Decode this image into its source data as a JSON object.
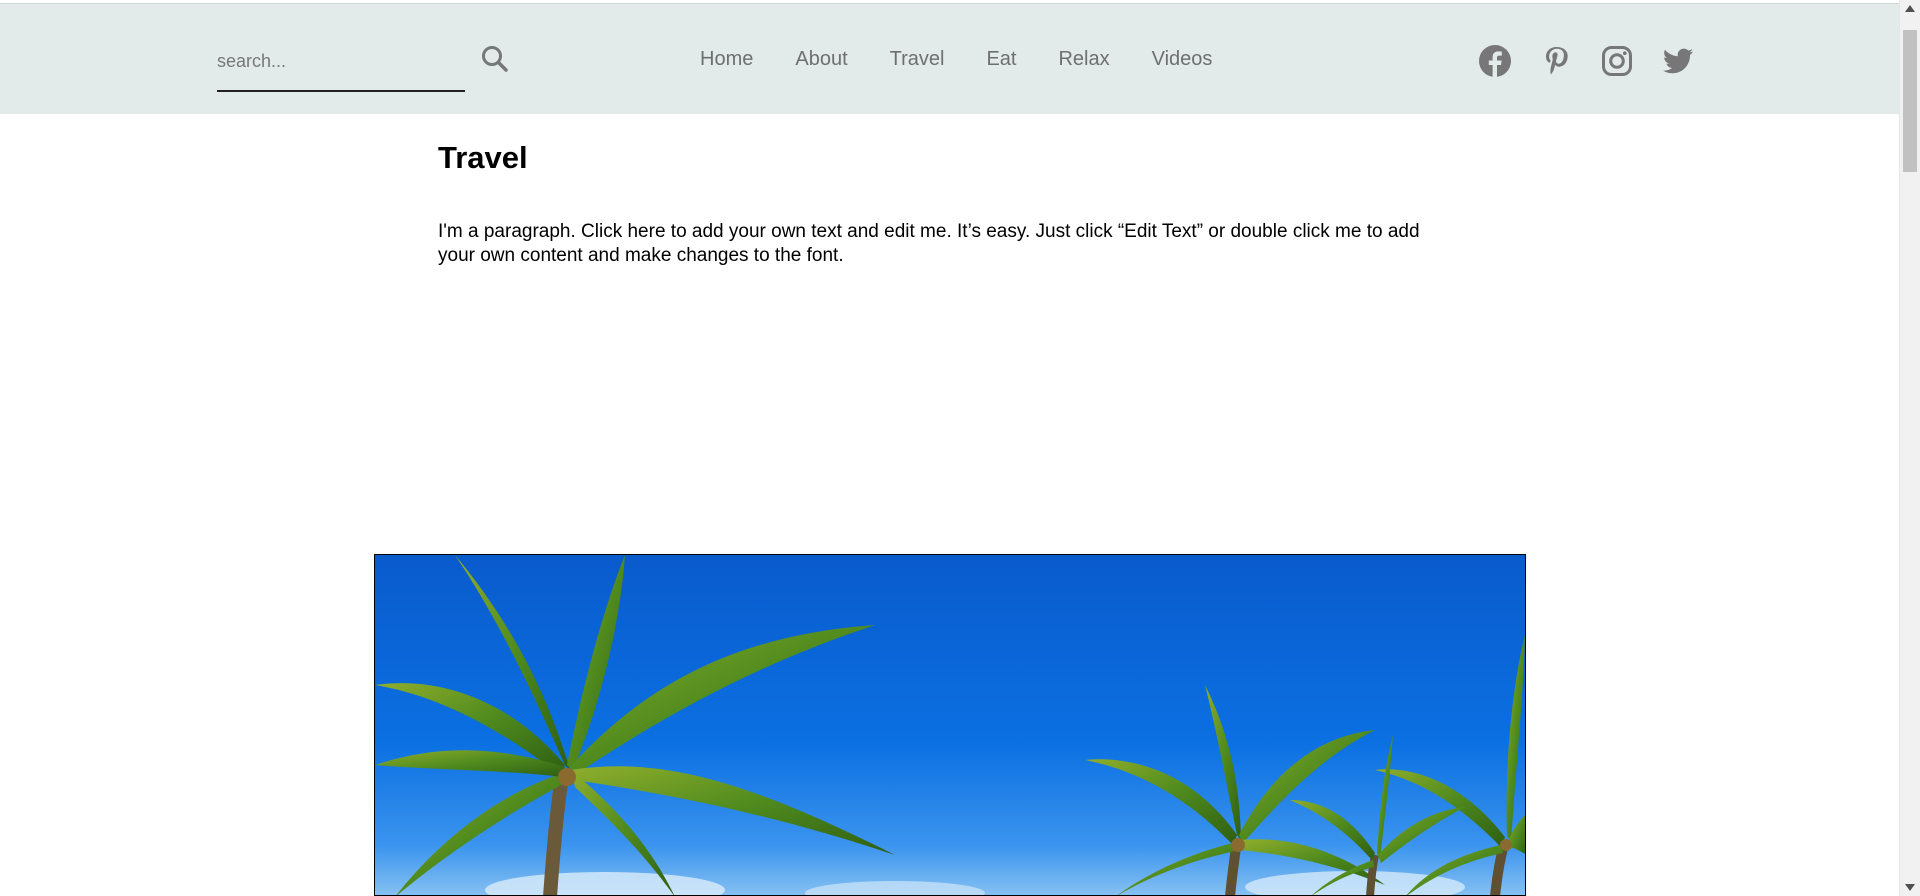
{
  "header": {
    "search": {
      "placeholder": "search...",
      "value": "",
      "icon": "search-icon"
    },
    "nav": [
      {
        "label": "Home"
      },
      {
        "label": "About"
      },
      {
        "label": "Travel"
      },
      {
        "label": "Eat"
      },
      {
        "label": "Relax"
      },
      {
        "label": "Videos"
      }
    ],
    "social": [
      {
        "icon": "facebook-icon"
      },
      {
        "icon": "pinterest-icon"
      },
      {
        "icon": "instagram-icon"
      },
      {
        "icon": "twitter-icon"
      }
    ],
    "colors": {
      "background": "#e2ebea",
      "nav_text": "#6f6f6f",
      "icon": "#777777"
    }
  },
  "main": {
    "title": "Travel",
    "paragraph": "I'm a paragraph. Click here to add your own text and edit me. It’s easy. Just click “Edit Text” or double click me to add your own content and make changes to the font."
  },
  "hero": {
    "alt_subject": "palm trees against blue sky",
    "colors": {
      "sky": "#0b6fe0",
      "palm_green": "#4f8a1e"
    }
  },
  "scrollbar": {
    "position": "top"
  }
}
